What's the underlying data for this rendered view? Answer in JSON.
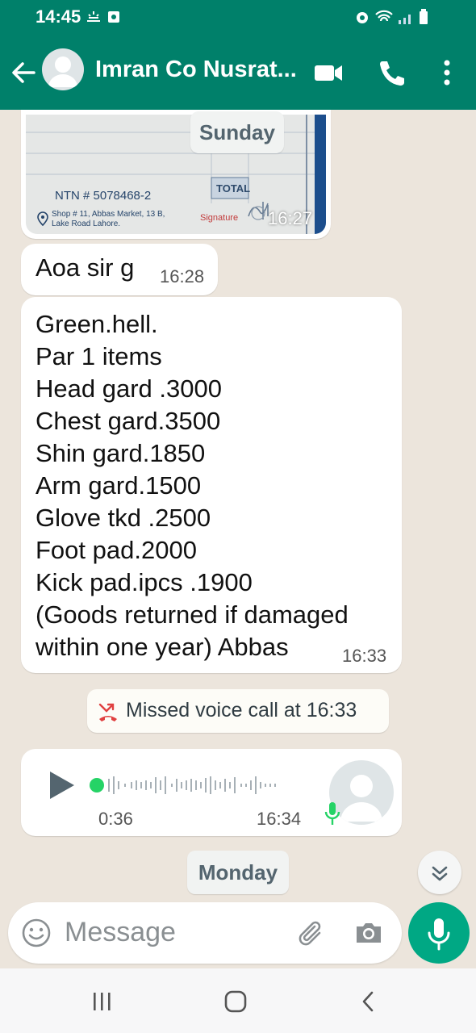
{
  "status": {
    "time": "14:45"
  },
  "header": {
    "contact_name": "Imran Co Nusrat..."
  },
  "chat": {
    "image_message": {
      "date_chip": "Sunday",
      "ntn": "NTN # 5078468-2",
      "total_label": "TOTAL",
      "address_line1": "Shop # 11, Abbas Market, 13 B,",
      "address_line2": "Lake Road Lahore.",
      "signature_label": "Signature",
      "time": "16:27"
    },
    "greeting": {
      "text": "Aoa sir g",
      "time": "16:28"
    },
    "price_list": {
      "lines": [
        "Green.hell.",
        "Par 1 items",
        "Head gard .3000",
        "Chest gard.3500",
        "Shin gard.1850",
        "Arm gard.1500",
        "Glove tkd .2500",
        "Foot pad.2000",
        "Kick pad.ipcs .1900",
        "(Goods returned if damaged",
        "within one year) Abbas"
      ],
      "time": "16:33"
    },
    "missed_call": {
      "label": "Missed voice call at 16:33"
    },
    "voice_note": {
      "duration": "0:36",
      "time": "16:34",
      "progress": 0.0
    },
    "date_chip_bottom": "Monday"
  },
  "composer": {
    "placeholder": "Message"
  },
  "colors": {
    "header": "#00806a",
    "mic_button": "#00a884",
    "missed_icon": "#e04040",
    "voice_dot": "#25d366"
  }
}
